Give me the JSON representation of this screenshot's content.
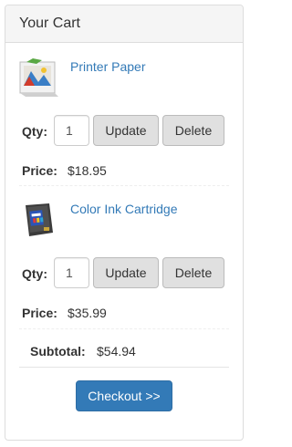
{
  "cart": {
    "title": "Your Cart",
    "qty_label": "Qty:",
    "price_label": "Price:",
    "update_label": "Update",
    "delete_label": "Delete",
    "items": [
      {
        "name": "Printer Paper",
        "qty": "1",
        "price": "$18.95",
        "icon": "printer-paper-image"
      },
      {
        "name": "Color Ink Cartridge",
        "qty": "1",
        "price": "$35.99",
        "icon": "ink-cartridge-image"
      }
    ],
    "subtotal_label": "Subtotal:",
    "subtotal_value": "$54.94",
    "checkout_label": "Checkout >>"
  },
  "colors": {
    "link": "#337ab7",
    "primary": "#337ab7",
    "heading_bg": "#f5f5f5",
    "button_bg": "#e0e0e0"
  }
}
